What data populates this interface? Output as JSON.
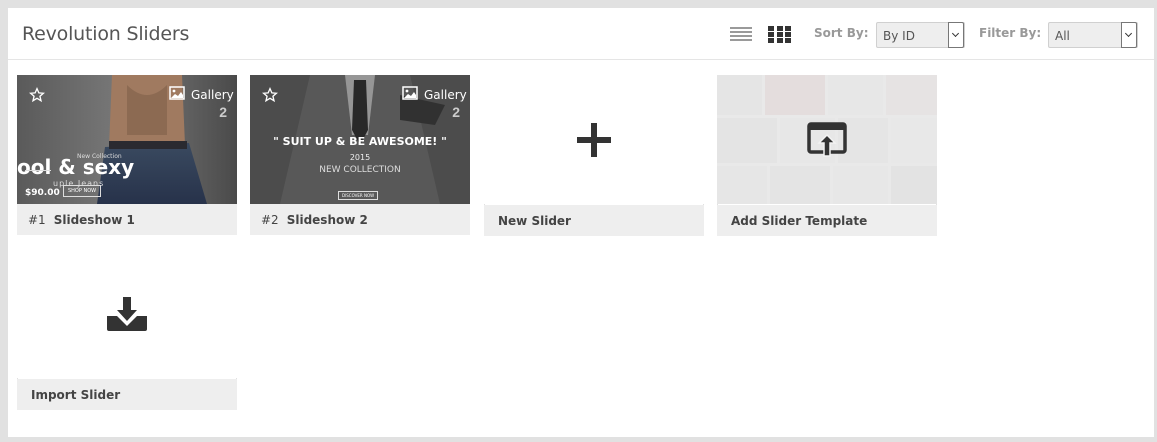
{
  "header": {
    "title": "Revolution Sliders",
    "sort_label": "Sort By:",
    "sort_value": "By ID",
    "filter_label": "Filter By:",
    "filter_value": "All"
  },
  "sliders": [
    {
      "number": "#1",
      "name": "Slideshow 1",
      "type": "Gallery",
      "slide_count": "2",
      "hero": {
        "line1": "ool & sexy",
        "line2": "uple Jeans",
        "price": "$90.00",
        "button": "SHOP NOW",
        "tagline": "New Collection"
      }
    },
    {
      "number": "#2",
      "name": "Slideshow 2",
      "type": "Gallery",
      "slide_count": "2",
      "hero": {
        "line1": "\" SUIT UP & BE AWESOME! \"",
        "year": "2015",
        "line2": "NEW COLLECTION",
        "button": "DISCOVER NOW"
      }
    }
  ],
  "actions": {
    "new_slider": "New Slider",
    "add_template": "Add Slider Template",
    "import_slider": "Import Slider"
  },
  "icons": {
    "list_view": "list-view-icon",
    "grid_view": "grid-view-icon",
    "star": "star-outline-icon",
    "gallery": "image-icon",
    "plus": "plus-icon",
    "template": "browser-upload-icon",
    "import": "download-tray-icon"
  },
  "colors": {
    "panel_bg": "#ffffff",
    "page_bg": "#e1e1e1",
    "footer_bg": "#eeeeee",
    "icon_dark": "#333333"
  }
}
